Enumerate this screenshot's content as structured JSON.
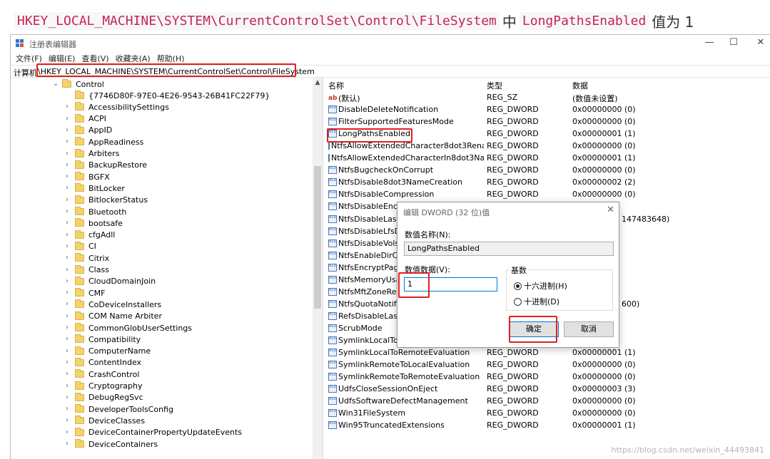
{
  "caption": {
    "path": "HKEY_LOCAL_MACHINE\\SYSTEM\\CurrentControlSet\\Control\\FileSystem",
    "mid": "中",
    "value_name": "LongPathsEnabled",
    "suffix": "值为 1"
  },
  "window": {
    "title": "注册表编辑器",
    "minimize": "—",
    "maximize": "☐",
    "close": "✕"
  },
  "menu": [
    "文件(F)",
    "编辑(E)",
    "查看(V)",
    "收藏夹(A)",
    "帮助(H)"
  ],
  "address": {
    "label": "计算机",
    "path": "\\HKEY_LOCAL_MACHINE\\SYSTEM\\CurrentControlSet\\Control\\FileSystem"
  },
  "tree": {
    "root": "Control",
    "children": [
      "{7746D80F-97E0-4E26-9543-26B41FC22F79}",
      "AccessibilitySettings",
      "ACPI",
      "AppID",
      "AppReadiness",
      "Arbiters",
      "BackupRestore",
      "BGFX",
      "BitLocker",
      "BitlockerStatus",
      "Bluetooth",
      "bootsafe",
      "cfgAdll",
      "CI",
      "Citrix",
      "Class",
      "CloudDomainJoin",
      "CMF",
      "CoDeviceInstallers",
      "COM Name Arbiter",
      "CommonGlobUserSettings",
      "Compatibility",
      "ComputerName",
      "ContentIndex",
      "CrashControl",
      "Cryptography",
      "DebugRegSvc",
      "DeveloperToolsConfig",
      "DeviceClasses",
      "DeviceContainerPropertyUpdateEvents",
      "DeviceContainers"
    ]
  },
  "list": {
    "headers": [
      "名称",
      "类型",
      "数据"
    ],
    "rows": [
      {
        "icon": "ab",
        "name": "(默认)",
        "type": "REG_SZ",
        "data": "(数值未设置)"
      },
      {
        "icon": "bin",
        "name": "DisableDeleteNotification",
        "type": "REG_DWORD",
        "data": "0x00000000 (0)"
      },
      {
        "icon": "bin",
        "name": "FilterSupportedFeaturesMode",
        "type": "REG_DWORD",
        "data": "0x00000000 (0)"
      },
      {
        "icon": "bin",
        "name": "LongPathsEnabled",
        "type": "REG_DWORD",
        "data": "0x00000001 (1)"
      },
      {
        "icon": "bin",
        "name": "NtfsAllowExtendedCharacter8dot3Rename",
        "type": "REG_DWORD",
        "data": "0x00000000 (0)"
      },
      {
        "icon": "bin",
        "name": "NtfsAllowExtendedCharacterIn8dot3Name",
        "type": "REG_DWORD",
        "data": "0x00000001 (1)"
      },
      {
        "icon": "bin",
        "name": "NtfsBugcheckOnCorrupt",
        "type": "REG_DWORD",
        "data": "0x00000000 (0)"
      },
      {
        "icon": "bin",
        "name": "NtfsDisable8dot3NameCreation",
        "type": "REG_DWORD",
        "data": "0x00000002 (2)"
      },
      {
        "icon": "bin",
        "name": "NtfsDisableCompression",
        "type": "REG_DWORD",
        "data": "0x00000000 (0)"
      },
      {
        "icon": "bin",
        "name": "NtfsDisableEncryption",
        "type": "",
        "data": ""
      },
      {
        "icon": "bin",
        "name": "NtfsDisableLastAccessUpdate",
        "type": "",
        "data": "147483648)"
      },
      {
        "icon": "bin",
        "name": "NtfsDisableLfsDowngrade",
        "type": "",
        "data": ""
      },
      {
        "icon": "bin",
        "name": "NtfsDisableVolsnapHints",
        "type": "",
        "data": ""
      },
      {
        "icon": "bin",
        "name": "NtfsEnableDirCaseSensitivity",
        "type": "",
        "data": ""
      },
      {
        "icon": "bin",
        "name": "NtfsEncryptPagingFile",
        "type": "",
        "data": ""
      },
      {
        "icon": "bin",
        "name": "NtfsMemoryUsage",
        "type": "",
        "data": ""
      },
      {
        "icon": "bin",
        "name": "NtfsMftZoneReservation",
        "type": "",
        "data": ""
      },
      {
        "icon": "bin",
        "name": "NtfsQuotaNotifyRate",
        "type": "",
        "data": "600)"
      },
      {
        "icon": "bin",
        "name": "RefsDisableLastAccessUpdate",
        "type": "",
        "data": ""
      },
      {
        "icon": "bin",
        "name": "ScrubMode",
        "type": "",
        "data": ""
      },
      {
        "icon": "bin",
        "name": "SymlinkLocalToLocalEvaluation",
        "type": "",
        "data": ""
      },
      {
        "icon": "bin",
        "name": "SymlinkLocalToRemoteEvaluation",
        "type": "REG_DWORD",
        "data": "0x00000001 (1)"
      },
      {
        "icon": "bin",
        "name": "SymlinkRemoteToLocalEvaluation",
        "type": "REG_DWORD",
        "data": "0x00000000 (0)"
      },
      {
        "icon": "bin",
        "name": "SymlinkRemoteToRemoteEvaluation",
        "type": "REG_DWORD",
        "data": "0x00000000 (0)"
      },
      {
        "icon": "bin",
        "name": "UdfsCloseSessionOnEject",
        "type": "REG_DWORD",
        "data": "0x00000003 (3)"
      },
      {
        "icon": "bin",
        "name": "UdfsSoftwareDefectManagement",
        "type": "REG_DWORD",
        "data": "0x00000000 (0)"
      },
      {
        "icon": "bin",
        "name": "Win31FileSystem",
        "type": "REG_DWORD",
        "data": "0x00000000 (0)"
      },
      {
        "icon": "bin",
        "name": "Win95TruncatedExtensions",
        "type": "REG_DWORD",
        "data": "0x00000001 (1)"
      }
    ]
  },
  "dialog": {
    "title": "编辑 DWORD (32 位)值",
    "close": "✕",
    "name_label": "数值名称(N):",
    "name_value": "LongPathsEnabled",
    "data_label": "数值数据(V):",
    "data_value": "1",
    "base_label": "基数",
    "hex_label": "十六进制(H)",
    "dec_label": "十进制(D)",
    "ok_label": "确定",
    "cancel_label": "取消"
  },
  "watermark": "https://blog.csdn.net/weixin_44493841",
  "colors": {
    "highlight": "#e02020",
    "folder": "#f5d36a",
    "accent": "#0078d7"
  }
}
